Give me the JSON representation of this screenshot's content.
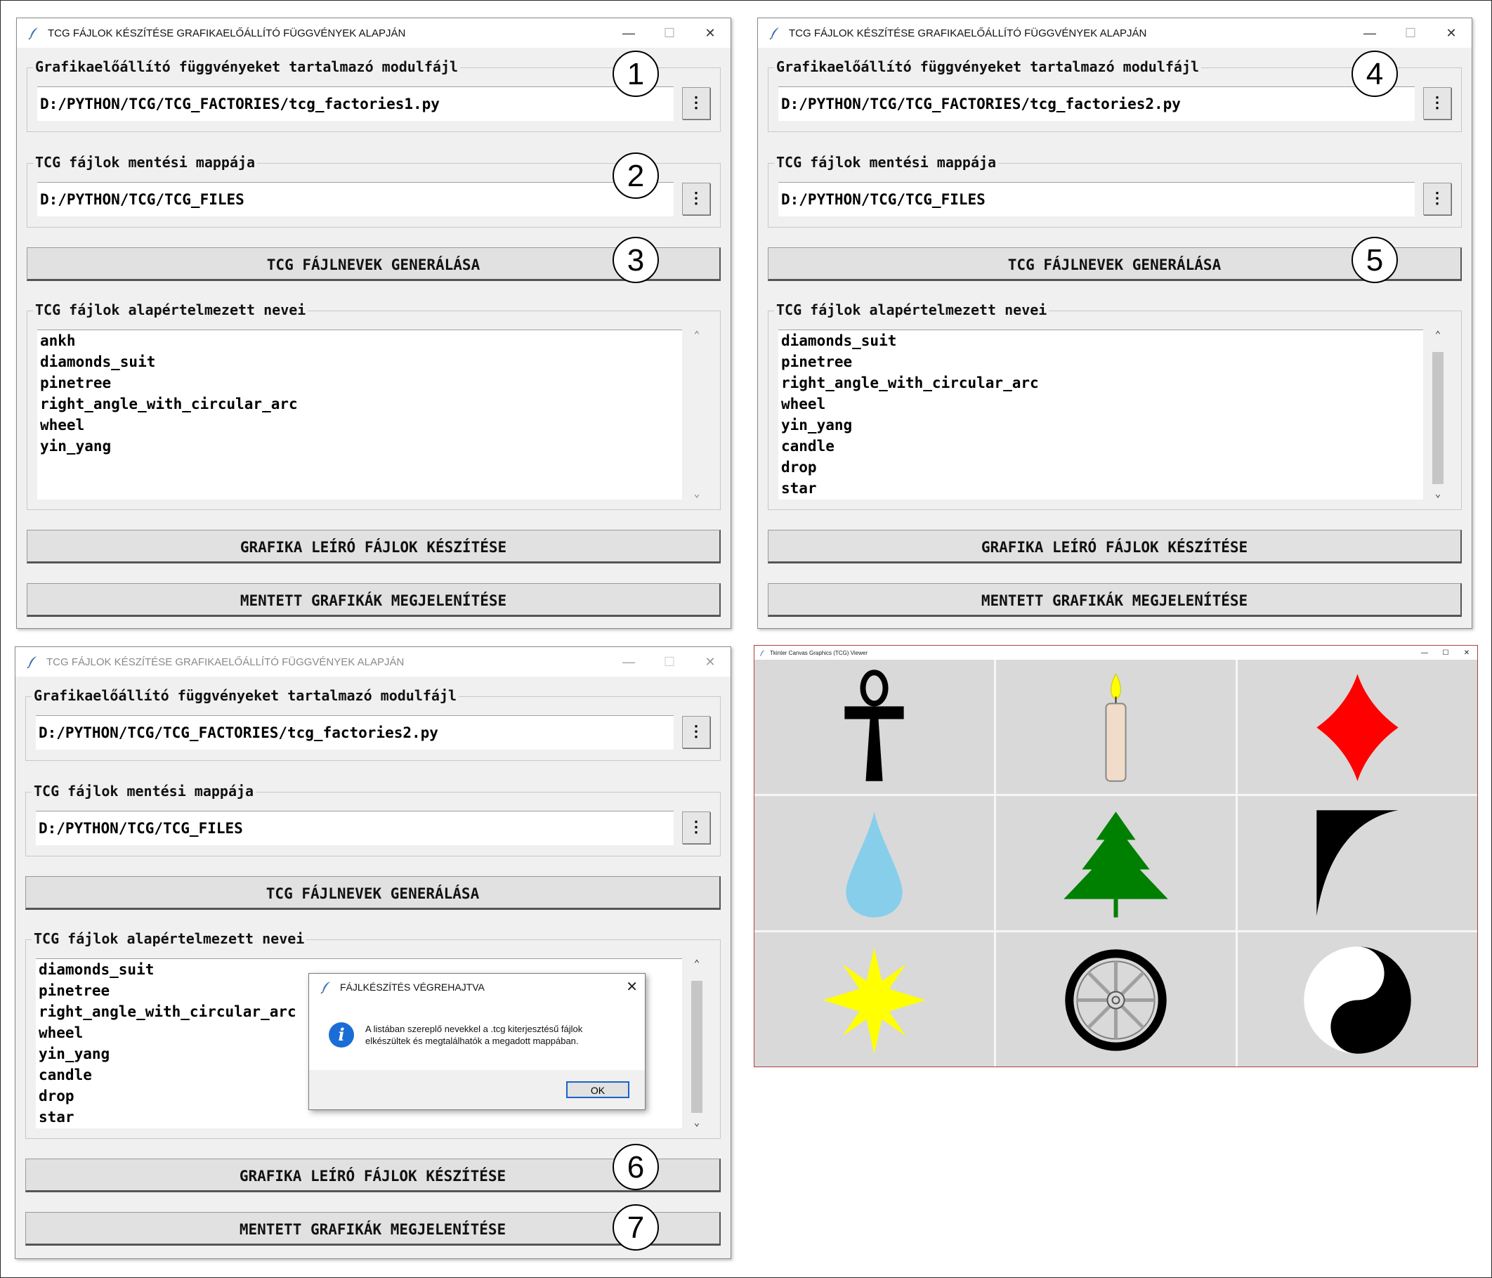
{
  "windows": [
    {
      "title": "TCG FÁJLOK KÉSZÍTÉSE GRAFIKAELŐÁLLÍTÓ FÜGGVÉNYEK ALAPJÁN",
      "module_legend": "Grafikaelőállító függvényeket tartalmazó modulfájl",
      "module_path": "D:/PYTHON/TCG/TCG_FACTORIES/tcg_factories1.py",
      "folder_legend": "TCG fájlok mentési mappája",
      "folder_path": "D:/PYTHON/TCG/TCG_FILES",
      "generate_button": "TCG FÁJLNEVEK GENERÁLÁSA",
      "list_legend": "TCG fájlok alapértelmezett nevei",
      "list_items": [
        "ankh",
        "diamonds_suit",
        "pinetree",
        "right_angle_with_circular_arc",
        "wheel",
        "yin_yang"
      ],
      "create_button": "GRAFIKA LEÍRÓ FÁJLOK KÉSZÍTÉSE",
      "show_button": "MENTETT GRAFIKÁK MEGJELENÍTÉSE",
      "browse_label": "⋮"
    },
    {
      "title": "TCG FÁJLOK KÉSZÍTÉSE GRAFIKAELŐÁLLÍTÓ FÜGGVÉNYEK ALAPJÁN",
      "module_legend": "Grafikaelőállító függvényeket tartalmazó modulfájl",
      "module_path": "D:/PYTHON/TCG/TCG_FACTORIES/tcg_factories2.py",
      "folder_legend": "TCG fájlok mentési mappája",
      "folder_path": "D:/PYTHON/TCG/TCG_FILES",
      "generate_button": "TCG FÁJLNEVEK GENERÁLÁSA",
      "list_legend": "TCG fájlok alapértelmezett nevei",
      "list_items": [
        "diamonds_suit",
        "pinetree",
        "right_angle_with_circular_arc",
        "wheel",
        "yin_yang",
        "candle",
        "drop",
        "star"
      ],
      "create_button": "GRAFIKA LEÍRÓ FÁJLOK KÉSZÍTÉSE",
      "show_button": "MENTETT GRAFIKÁK MEGJELENÍTÉSE",
      "browse_label": "⋮"
    },
    {
      "title": "TCG FÁJLOK KÉSZÍTÉSE GRAFIKAELŐÁLLÍTÓ FÜGGVÉNYEK ALAPJÁN",
      "module_legend": "Grafikaelőállító függvényeket tartalmazó modulfájl",
      "module_path": "D:/PYTHON/TCG/TCG_FACTORIES/tcg_factories2.py",
      "folder_legend": "TCG fájlok mentési mappája",
      "folder_path": "D:/PYTHON/TCG/TCG_FILES",
      "generate_button": "TCG FÁJLNEVEK GENERÁLÁSA",
      "list_legend": "TCG fájlok alapértelmezett nevei",
      "list_items": [
        "diamonds_suit",
        "pinetree",
        "right_angle_with_circular_arc",
        "wheel",
        "yin_yang",
        "candle",
        "drop",
        "star"
      ],
      "create_button": "GRAFIKA LEÍRÓ FÁJLOK KÉSZÍTÉSE",
      "show_button": "MENTETT GRAFIKÁK MEGJELENÍTÉSE",
      "browse_label": "⋮"
    }
  ],
  "window_controls": {
    "minimize": "—",
    "maximize": "☐",
    "close": "✕"
  },
  "callouts": [
    "1",
    "2",
    "3",
    "4",
    "5",
    "6",
    "7"
  ],
  "dialog": {
    "title": "FÁJLKÉSZÍTÉS VÉGREHAJTVA",
    "icon": "info-icon",
    "icon_glyph": "i",
    "message": "A listában szereplő nevekkel a .tcg kiterjesztésű fájlok elkészültek és megtalálhatók a megadott mappában.",
    "ok_button": "OK",
    "close": "✕"
  },
  "viewer": {
    "title": "Tkinter Canvas Graphics (TCG) Viewer",
    "controls": {
      "minimize": "—",
      "maximize": "☐",
      "close": "✕"
    },
    "graphics": [
      "ankh",
      "candle",
      "diamonds_suit",
      "drop",
      "pinetree",
      "right_angle_with_circular_arc",
      "star",
      "wheel",
      "yin_yang"
    ]
  },
  "colors": {
    "window_bg": "#f0f0f0",
    "canvas_bg": "#d9d9d9",
    "diamond": "#ff0000",
    "drop": "#87ceeb",
    "pinetree": "#008000",
    "star": "#ffff00",
    "info_blue": "#1a6dd6"
  }
}
